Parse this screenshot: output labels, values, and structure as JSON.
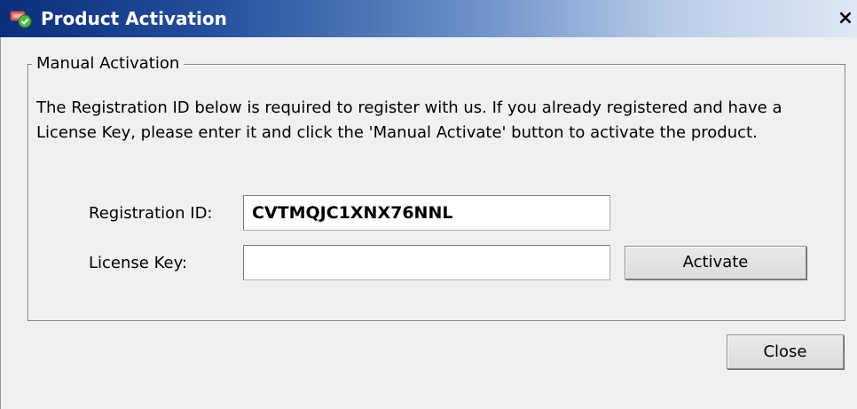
{
  "window": {
    "title": "Product Activation",
    "close_glyph": "×",
    "app_icon": "product-activation-app-icon"
  },
  "manual_activation": {
    "group_label": "Manual Activation",
    "description": "The Registration ID below is required to register with us. If you already registered and have a License Key, please enter it and click the 'Manual Activate' button to activate the product.",
    "registration_id_label": "Registration ID:",
    "registration_id_value": "CVTMQJC1XNX76NNL",
    "license_key_label": "License Key:",
    "license_key_value": "",
    "activate_label": "Activate"
  },
  "footer": {
    "close_label": "Close"
  },
  "colors": {
    "titlebar_start": "#0a2e7c",
    "titlebar_end": "#dfe8f4",
    "dialog_background": "#f0f0f0"
  }
}
